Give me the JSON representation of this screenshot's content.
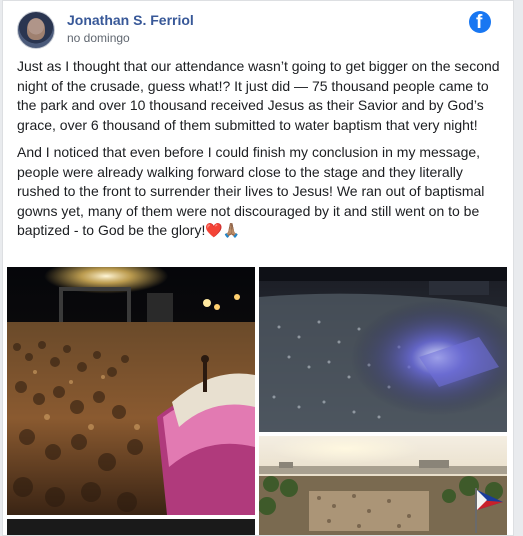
{
  "post": {
    "author": "Jonathan S. Ferriol",
    "timestamp": "no domingo",
    "platform_icon": "facebook-icon",
    "paragraphs": [
      "Just as I thought that our attendance wasn’t going to get bigger on the second night of the crusade, guess what!? It just did — 75 thousand people came to the park and over 10 thousand received Jesus as their Savior and by God’s grace, over 6 thousand of them submitted to water baptism that very night!",
      "And I noticed that even before I could finish my conclusion in my message, people were already walking forward close to the stage and they literally rushed to the front to surrender their lives to Jesus! We ran out of baptismal gowns yet, many of them were not discouraged by it and still went on to be baptized - to God be the glory!"
    ],
    "emoji": {
      "heart": "❤️",
      "hands": "🙏🏽"
    },
    "photos": [
      "crowd-stage-photo",
      "aerial-night-crowd-photo",
      "aerial-day-park-photo",
      "additional-photo"
    ]
  },
  "colors": {
    "author": "#385898",
    "facebook_blue": "#1877f2",
    "text": "#1c1e21",
    "meta": "#606770"
  }
}
